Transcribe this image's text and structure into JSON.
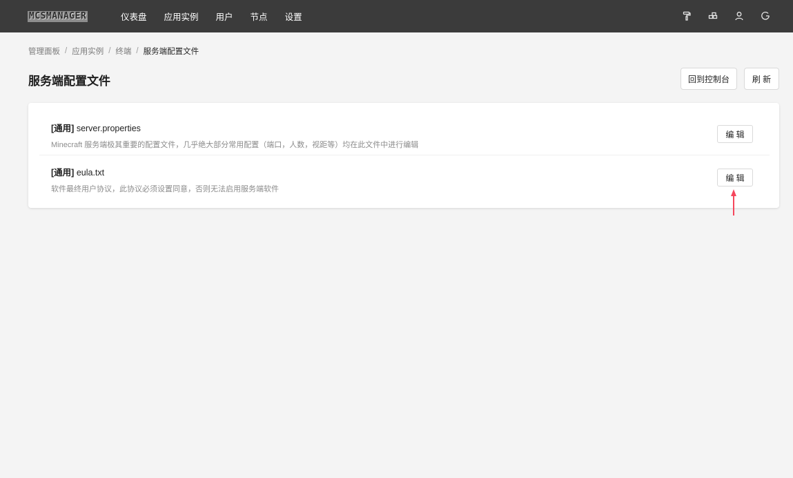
{
  "app": {
    "logo": "MCSMANAGER",
    "nav": [
      "仪表盘",
      "应用实例",
      "用户",
      "节点",
      "设置"
    ],
    "icons": [
      "paint-roller-icon",
      "network-icon",
      "user-icon",
      "logout-icon"
    ]
  },
  "breadcrumb": {
    "items": [
      "管理面板",
      "应用实例",
      "终端"
    ],
    "current": "服务端配置文件"
  },
  "page": {
    "title": "服务端配置文件",
    "console_button": "回到控制台",
    "refresh_button": "刷 新"
  },
  "files": [
    {
      "tag": "[通用]",
      "name": "server.properties",
      "description": "Minecraft 服务端极其重要的配置文件，几乎绝大部分常用配置（端口，人数，视距等）均在此文件中进行编辑",
      "edit_label": "编 辑"
    },
    {
      "tag": "[通用]",
      "name": "eula.txt",
      "description": "软件最终用户协议，此协议必须设置同意，否则无法启用服务端软件",
      "edit_label": "编 辑"
    }
  ],
  "colors": {
    "topbar": "#3b3b3b",
    "background": "#f4f4f4",
    "annotation_arrow": "#f5465c"
  }
}
